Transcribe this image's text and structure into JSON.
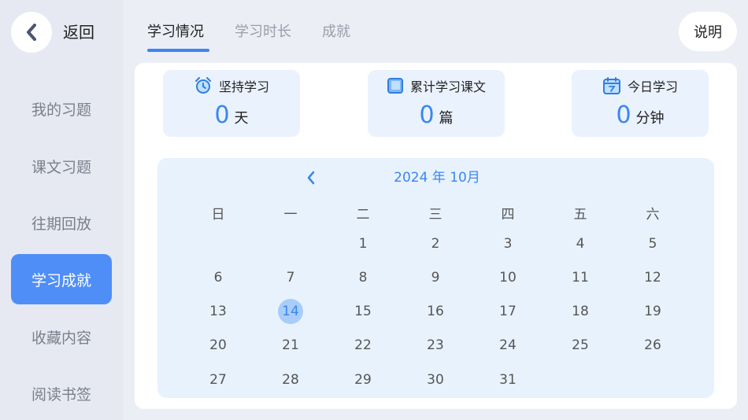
{
  "header": {
    "back_label": "返回",
    "help_label": "说明",
    "tabs": [
      {
        "label": "学习情况",
        "active": true
      },
      {
        "label": "学习时长",
        "active": false
      },
      {
        "label": "成就",
        "active": false
      }
    ]
  },
  "sidebar": {
    "items": [
      {
        "label": "我的习题",
        "active": false
      },
      {
        "label": "课文习题",
        "active": false
      },
      {
        "label": "往期回放",
        "active": false
      },
      {
        "label": "学习成就",
        "active": true
      },
      {
        "label": "收藏内容",
        "active": false
      },
      {
        "label": "阅读书签",
        "active": false
      }
    ]
  },
  "stats": [
    {
      "icon": "alarm-clock-icon",
      "label": "坚持学习",
      "value": "0",
      "unit": "天"
    },
    {
      "icon": "book-icon",
      "label": "累计学习课文",
      "value": "0",
      "unit": "篇"
    },
    {
      "icon": "calendar-today-icon",
      "label": "今日学习",
      "value": "0",
      "unit": "分钟"
    }
  ],
  "calendar": {
    "title": "2024 年 10月",
    "weekdays": [
      "日",
      "一",
      "二",
      "三",
      "四",
      "五",
      "六"
    ],
    "weeks": [
      [
        "",
        "",
        "1",
        "2",
        "3",
        "4",
        "5"
      ],
      [
        "6",
        "7",
        "8",
        "9",
        "10",
        "11",
        "12"
      ],
      [
        "13",
        "14",
        "15",
        "16",
        "17",
        "18",
        "19"
      ],
      [
        "20",
        "21",
        "22",
        "23",
        "24",
        "25",
        "26"
      ],
      [
        "27",
        "28",
        "29",
        "30",
        "31",
        "",
        ""
      ]
    ],
    "today": "14"
  },
  "colors": {
    "accent": "#3a86f0",
    "sidebar_active": "#4f8ef7",
    "card_bg": "#eaf2fd",
    "today_bg": "#a9cdf8"
  }
}
